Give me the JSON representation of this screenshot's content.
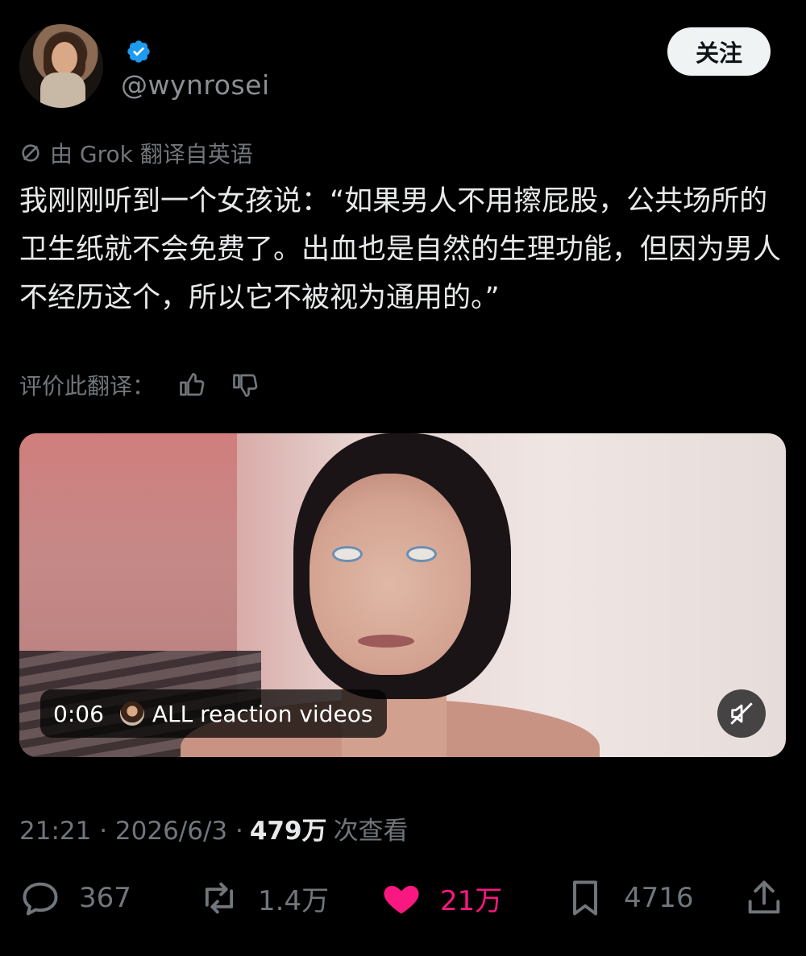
{
  "author": {
    "handle": "@wynrosei",
    "verified": true,
    "follow_label": "关注"
  },
  "translation_note": "由 Grok 翻译自英语",
  "tweet_text": "我刚刚听到一个女孩说：“如果男人不用擦屁股，公共场所的卫生纸就不会免费了。出血也是自然的生理功能，但因为男人不经历这个，所以它不被视为通用的。”",
  "rate_translation": {
    "label": "评价此翻译："
  },
  "video": {
    "duration": "0:06",
    "channel": "ALL reaction videos",
    "muted": true
  },
  "meta": {
    "time": "21:21 · 2026/6/3 ·",
    "views": "479万",
    "views_suffix": "次查看"
  },
  "actions": {
    "replies": "367",
    "reposts": "1.4万",
    "likes": "21万",
    "bookmarks": "4716"
  },
  "colors": {
    "like": "#f91880",
    "verified": "#1d9bf0",
    "muted_text": "#71767b"
  }
}
